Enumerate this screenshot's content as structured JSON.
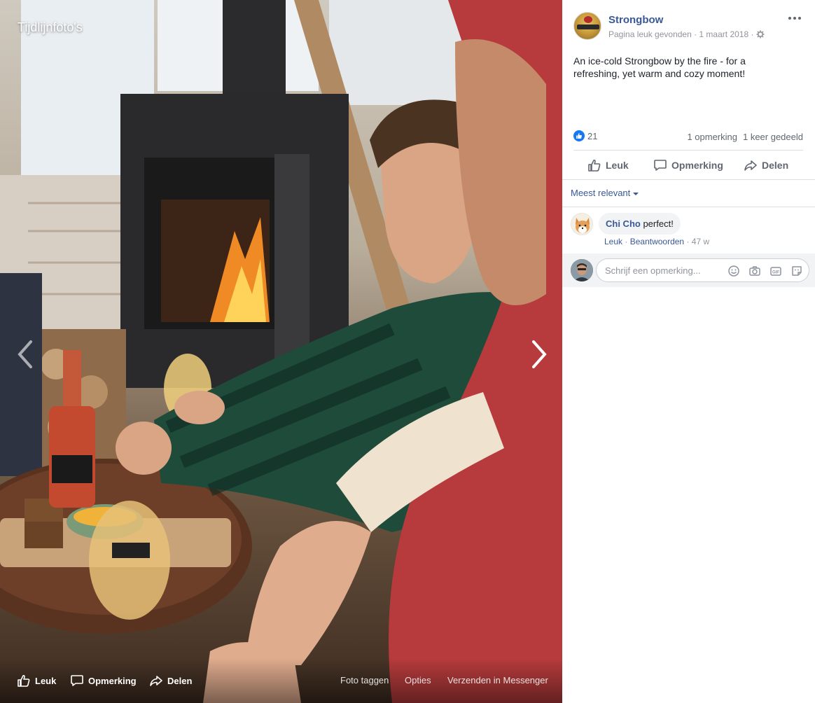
{
  "photo": {
    "album_title": "Tijdlijnfoto's",
    "actions": {
      "like": "Leuk",
      "comment": "Opmerking",
      "share": "Delen"
    },
    "links": {
      "tag": "Foto taggen",
      "options": "Opties",
      "messenger": "Verzenden in Messenger"
    }
  },
  "post": {
    "page_name": "Strongbow",
    "meta": "Pagina leuk gevonden · 1 maart 2018 ·",
    "text": "An ice-cold Strongbow by the fire - for a refreshing, yet warm and cozy moment!",
    "reaction_count": "21",
    "comments_count": "1 opmerking",
    "shares_count": "1 keer gedeeld",
    "actions": {
      "like": "Leuk",
      "comment": "Opmerking",
      "share": "Delen"
    }
  },
  "comments": {
    "sort_label": "Meest relevant",
    "items": [
      {
        "author": "Chi Cho",
        "text": "perfect!",
        "like": "Leuk",
        "reply": "Beantwoorden",
        "age": "47 w"
      }
    ],
    "composer_placeholder": "Schrijf een opmerking..."
  },
  "colors": {
    "link": "#385898",
    "like_blue": "#1877f2",
    "muted": "#90949c"
  },
  "icons": [
    "chevron-left-icon",
    "chevron-right-icon",
    "thumbs-up-icon",
    "comment-icon",
    "share-icon",
    "gear-icon",
    "more-icon",
    "emoji-icon",
    "camera-icon",
    "gif-icon",
    "sticker-icon"
  ]
}
